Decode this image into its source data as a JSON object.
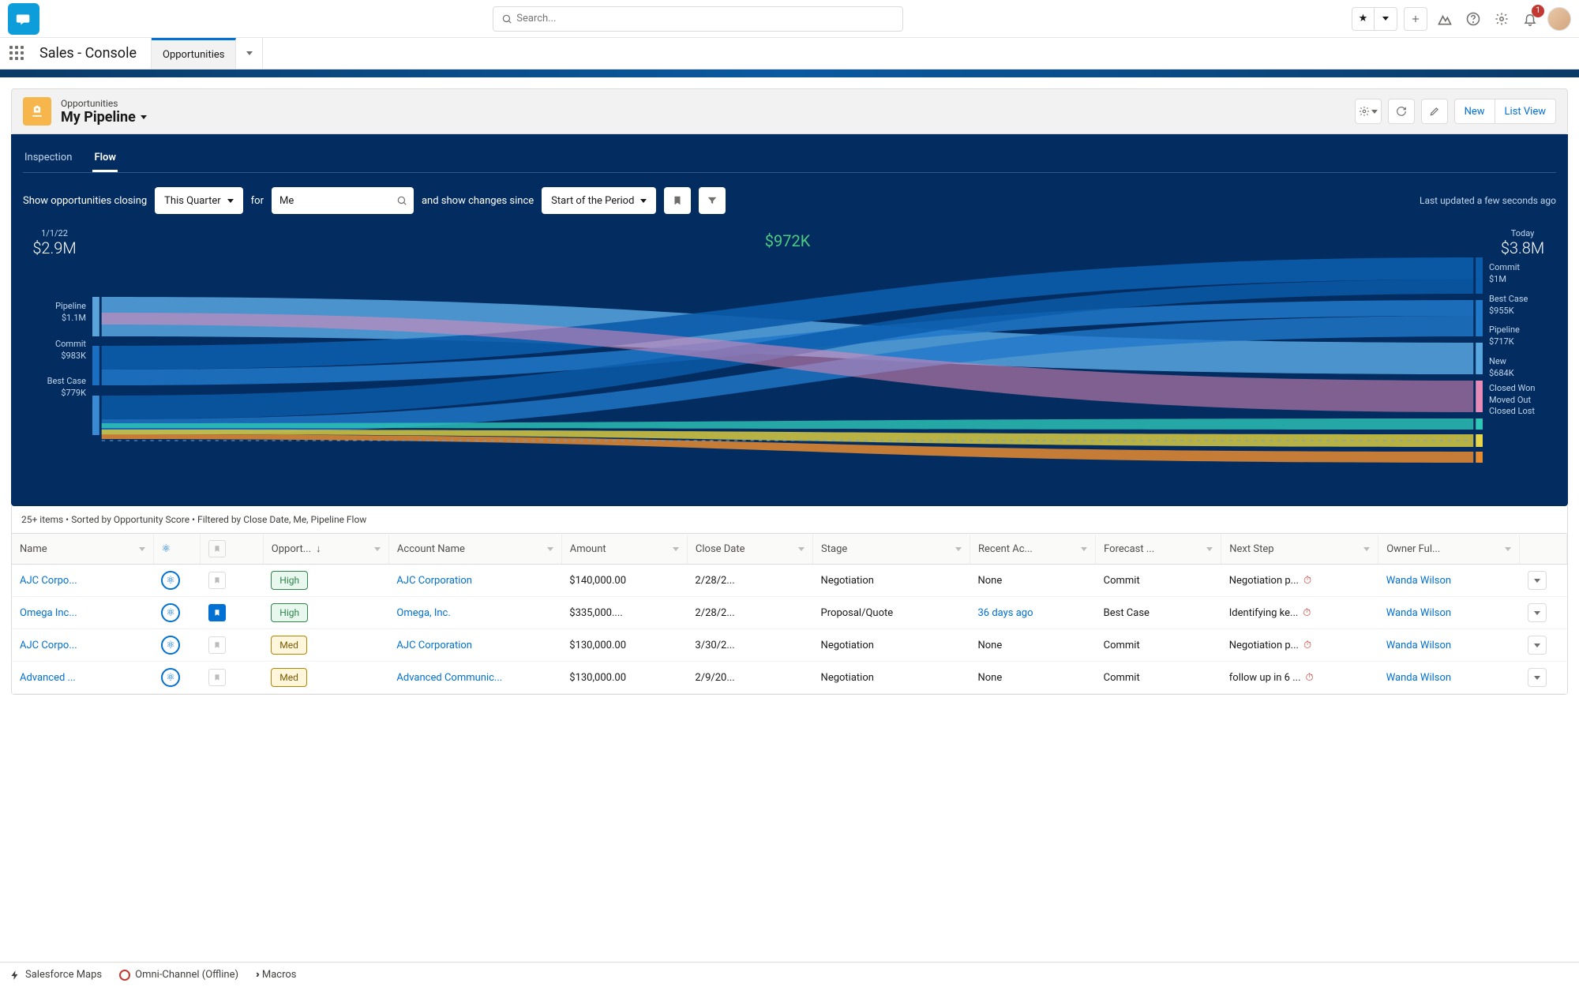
{
  "header": {
    "search_placeholder": "Search...",
    "notification_count": "1",
    "app_name": "Sales - Console",
    "tab_label": "Opportunities"
  },
  "page": {
    "object_label": "Opportunities",
    "view_title": "My Pipeline",
    "actions": {
      "new": "New",
      "list_view": "List View"
    }
  },
  "subtabs": {
    "inspection": "Inspection",
    "flow": "Flow"
  },
  "filters": {
    "label1": "Show opportunities closing",
    "picker1": "This Quarter",
    "label2": "for",
    "picker2": "Me",
    "label3": "and show changes since",
    "picker3": "Start of the Period",
    "last_updated": "Last updated a few seconds ago"
  },
  "flow": {
    "gain": "$972K",
    "left_date": "1/1/22",
    "left_total": "$2.9M",
    "right_date": "Today",
    "right_total": "$3.8M"
  },
  "flow_left": [
    {
      "label": "Pipeline",
      "value": "$1.1M"
    },
    {
      "label": "Commit",
      "value": "$983K"
    },
    {
      "label": "Best Case",
      "value": "$779K"
    }
  ],
  "flow_right": [
    {
      "label": "Commit",
      "value": "$1M"
    },
    {
      "label": "Best Case",
      "value": "$955K"
    },
    {
      "label": "Pipeline",
      "value": "$717K"
    },
    {
      "label": "New",
      "value": "$684K"
    },
    {
      "label": "Closed Won",
      "value": ""
    },
    {
      "label": "Moved Out",
      "value": ""
    },
    {
      "label": "Closed Lost",
      "value": ""
    }
  ],
  "meta": "25+ items • Sorted by Opportunity Score • Filtered by Close Date, Me, Pipeline Flow",
  "cols": {
    "name": "Name",
    "bm": "",
    "opp": "Opport...",
    "acct": "Account Name",
    "amt": "Amount",
    "close": "Close Date",
    "stage": "Stage",
    "recent": "Recent Ac...",
    "fc": "Forecast ...",
    "next": "Next Step",
    "owner": "Owner Ful..."
  },
  "rows": [
    {
      "name": "AJC Corpo...",
      "bm": "off",
      "score": "High",
      "score_class": "high",
      "acct": "AJC Corporation",
      "amt": "$140,000.00",
      "close": "2/28/2...",
      "stage": "Negotiation",
      "recent": "None",
      "recent_link": false,
      "fc": "Commit",
      "next": "Negotiation p...",
      "owner": "Wanda Wilson"
    },
    {
      "name": "Omega Inc...",
      "bm": "on",
      "score": "High",
      "score_class": "high",
      "acct": "Omega, Inc.",
      "amt": "$335,000....",
      "close": "2/28/2...",
      "stage": "Proposal/Quote",
      "recent": "36 days ago",
      "recent_link": true,
      "fc": "Best Case",
      "next": "Identifying ke...",
      "owner": "Wanda Wilson"
    },
    {
      "name": "AJC Corpo...",
      "bm": "off",
      "score": "Med",
      "score_class": "med",
      "acct": "AJC Corporation",
      "amt": "$130,000.00",
      "close": "3/30/2...",
      "stage": "Negotiation",
      "recent": "None",
      "recent_link": false,
      "fc": "Commit",
      "next": "Negotiation p...",
      "owner": "Wanda Wilson"
    },
    {
      "name": "Advanced ...",
      "bm": "off",
      "score": "Med",
      "score_class": "med",
      "acct": "Advanced Communic...",
      "amt": "$130,000.00",
      "close": "2/9/20...",
      "stage": "Negotiation",
      "recent": "None",
      "recent_link": false,
      "fc": "Commit",
      "next": "follow up in 6 ...",
      "owner": "Wanda Wilson"
    }
  ],
  "util": {
    "maps": "Salesforce Maps",
    "omni": "Omni-Channel (Offline)",
    "macros": "Macros"
  },
  "chart_data": {
    "type": "sankey",
    "title": "Pipeline Flow",
    "unit": "USD",
    "gain": 972000,
    "left": {
      "date": "2022-01-01",
      "total": 2900000,
      "nodes": [
        {
          "name": "Pipeline",
          "value": 1100000
        },
        {
          "name": "Commit",
          "value": 983000
        },
        {
          "name": "Best Case",
          "value": 779000
        }
      ]
    },
    "right": {
      "date": "Today",
      "total": 3800000,
      "nodes": [
        {
          "name": "Commit",
          "value": 1000000
        },
        {
          "name": "Best Case",
          "value": 955000
        },
        {
          "name": "Pipeline",
          "value": 717000
        },
        {
          "name": "New",
          "value": 684000
        },
        {
          "name": "Closed Won",
          "value": null
        },
        {
          "name": "Moved Out",
          "value": null
        },
        {
          "name": "Closed Lost",
          "value": null
        }
      ]
    }
  }
}
